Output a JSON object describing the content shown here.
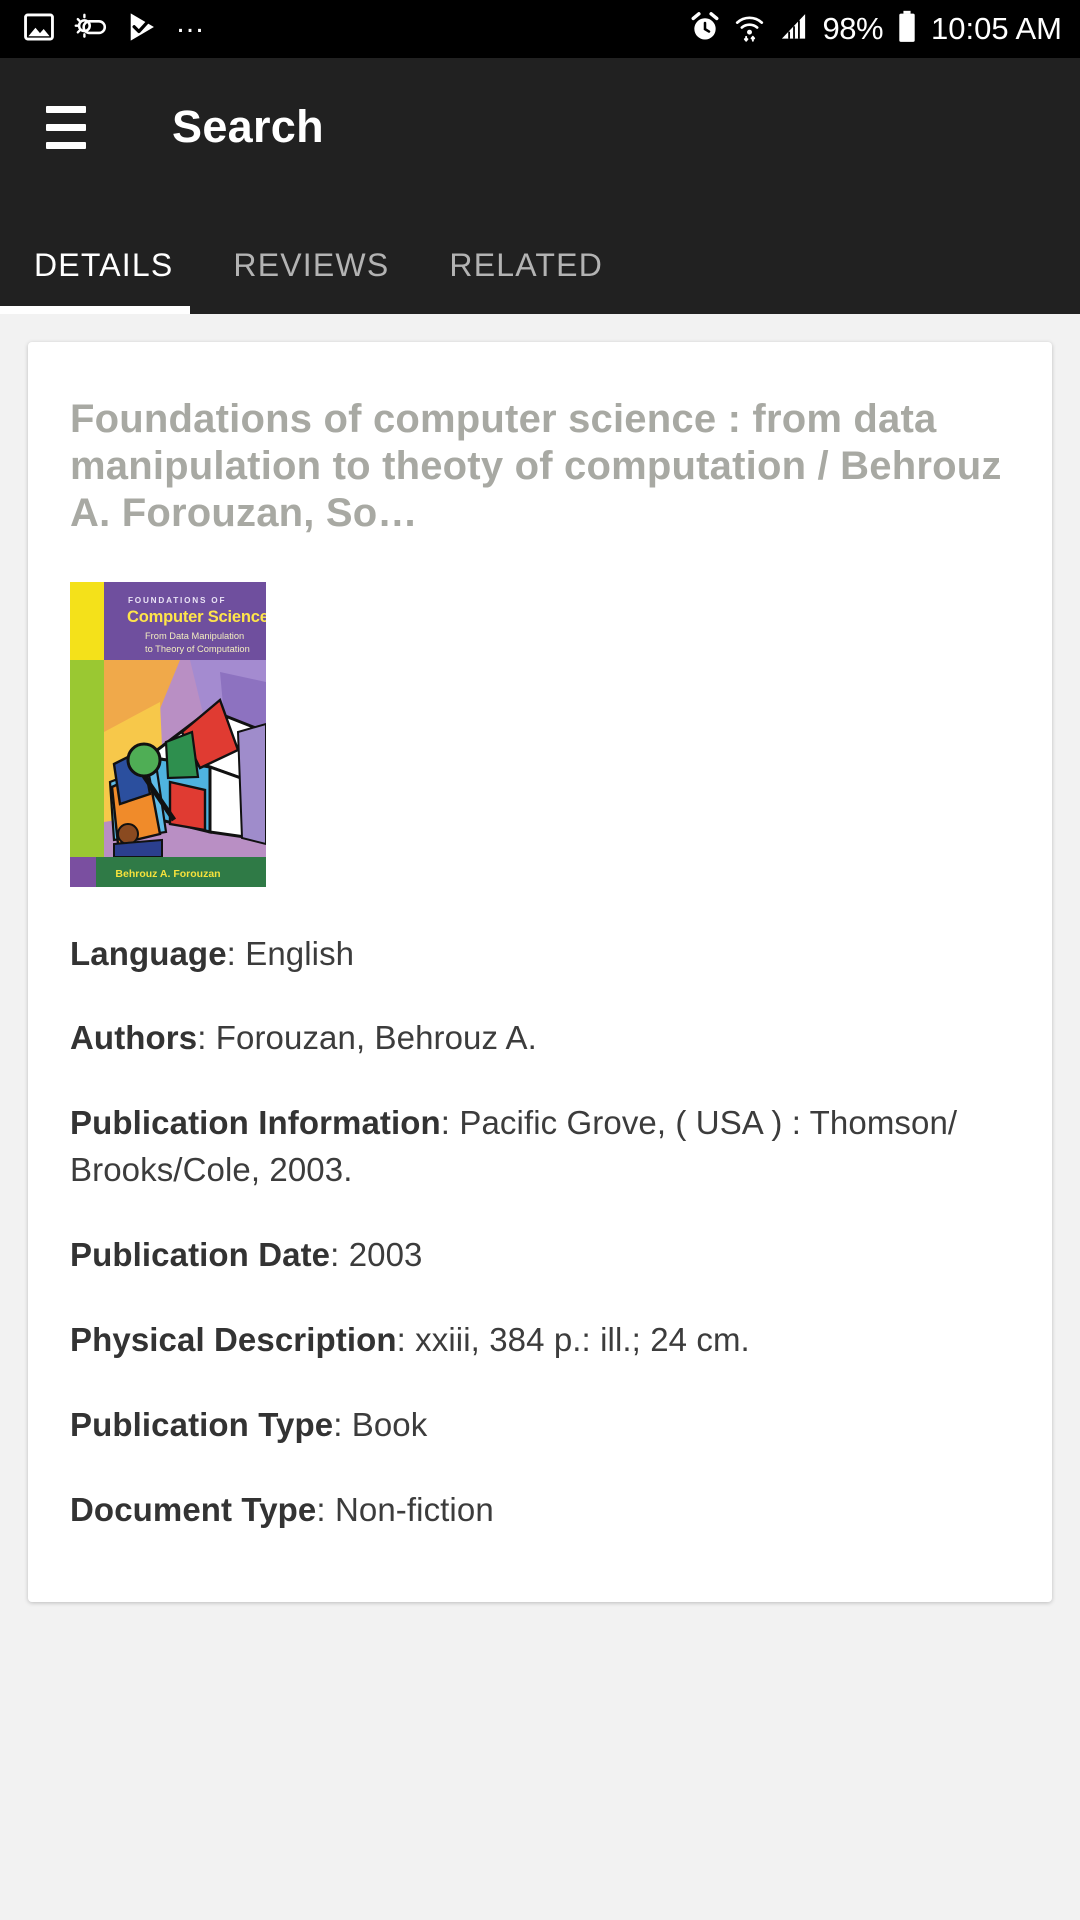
{
  "statusbar": {
    "left_icons": [
      "image-icon",
      "weather-partly-cloudy-icon",
      "play-check-icon"
    ],
    "overflow": "…",
    "icons_right": [
      "alarm-icon",
      "wifi-icon",
      "signal-icon"
    ],
    "battery_percent": "98%",
    "battery_icon": "battery-full-icon",
    "time": "10:05 AM"
  },
  "appbar": {
    "menu_icon": "hamburger-menu-icon",
    "title": "Search"
  },
  "tabs": [
    {
      "label": "DETAILS",
      "active": true
    },
    {
      "label": "REVIEWS",
      "active": false
    },
    {
      "label": "RELATED",
      "active": false
    }
  ],
  "book": {
    "title": "Foundations of computer science : from data manipulation to theoty of computation / Behrouz A. Forouzan, So…",
    "cover": {
      "alt": "book-cover-foundations-of-computer-science",
      "heading_small": "FOUNDATIONS OF",
      "heading_main": "Computer Science",
      "subtitle_line1": "From Data Manipulation",
      "subtitle_line2": "to Theory of Computation",
      "author_band": "Behrouz A. Forouzan",
      "colors": {
        "purple": "#6f4f9e",
        "yellow": "#f4e11a",
        "green_side": "#9ac832",
        "green_band": "#2f7a46",
        "violet": "#7a4fa0",
        "title_yellow": "#ffe54a",
        "subtitle_cream": "#f3eec0"
      }
    },
    "fields": [
      {
        "label": "Language",
        "value": "English"
      },
      {
        "label": "Authors",
        "value": "Forouzan, Behrouz A."
      },
      {
        "label": "Publication Information",
        "value": "Pacific Grove, ( USA ) : Thomson/ Brooks/Cole, 2003."
      },
      {
        "label": "Publication Date",
        "value": "2003"
      },
      {
        "label": "Physical Description",
        "value": "xxiii, 384 p.: ill.; 24 cm."
      },
      {
        "label": "Publication Type",
        "value": "Book"
      },
      {
        "label": "Document Type",
        "value": "Non-fiction"
      }
    ]
  },
  "theme": {
    "appbar_bg": "#212121",
    "status_bg": "#000000",
    "page_bg": "#f2f2f2",
    "card_bg": "#ffffff",
    "tab_active": "#ffffff",
    "tab_inactive": "#b3b3b3",
    "title_color": "#a8a9a3",
    "text_color": "#3c3c3c"
  }
}
